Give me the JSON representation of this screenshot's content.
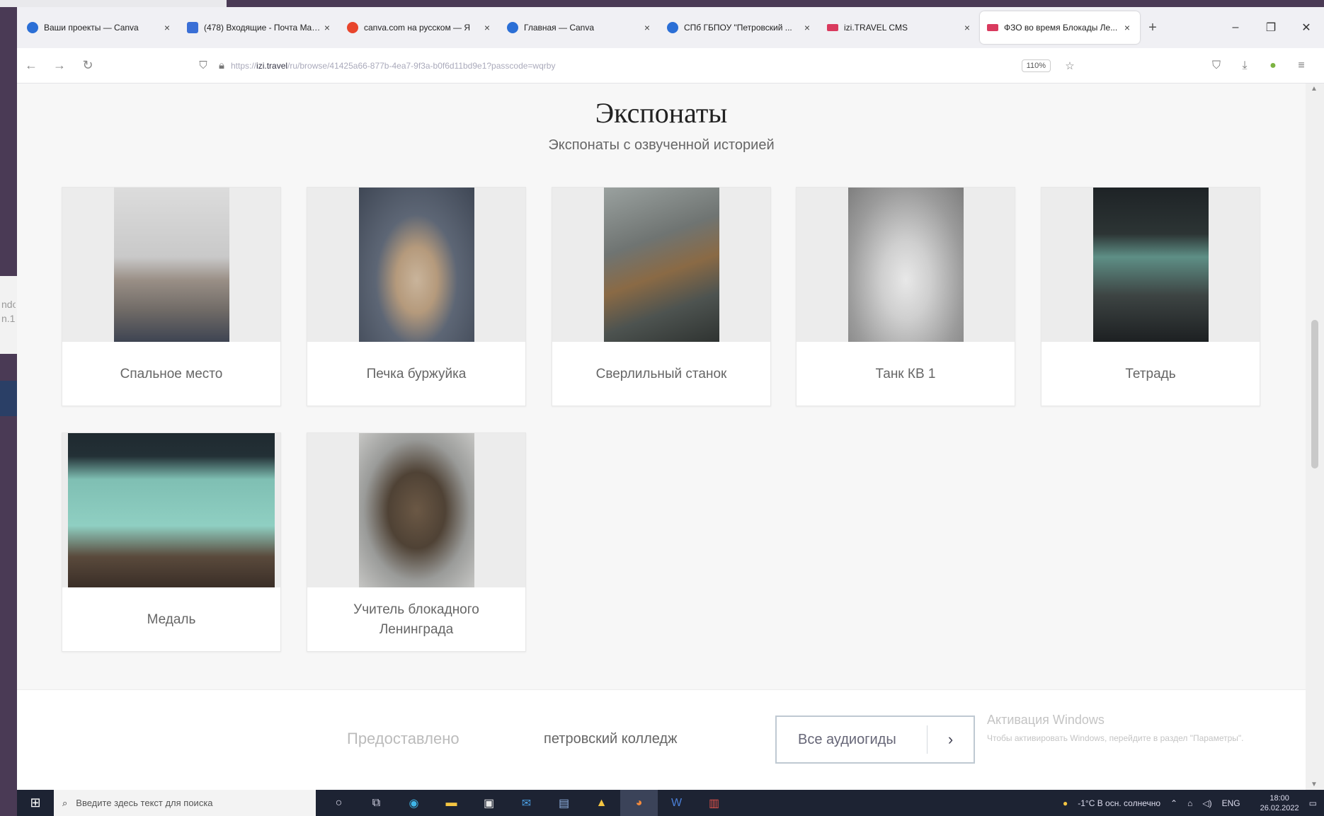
{
  "browser": {
    "tabs": [
      {
        "title": "Ваши проекты — Canva",
        "favicon_color": "#2b6fd6",
        "active": false
      },
      {
        "title": "(478) Входящие - Почта Mail.ru",
        "favicon_color": "#3a6fd6",
        "active": false
      },
      {
        "title": "canva.com на русском — Я",
        "favicon_color": "#e8452c",
        "active": false
      },
      {
        "title": "Главная — Canva",
        "favicon_color": "#2b6fd6",
        "active": false
      },
      {
        "title": "СПб ГБПОУ \"Петровский ...",
        "favicon_color": "#2b6fd6",
        "active": false
      },
      {
        "title": "izi.TRAVEL CMS",
        "favicon_color": "#d93a5e",
        "active": false
      },
      {
        "title": "ФЗО во время Блокады Ле...",
        "favicon_color": "#d93a5e",
        "active": true
      }
    ],
    "new_tab": "+",
    "window_controls": {
      "minimize": "–",
      "restore": "❐",
      "close": "✕"
    },
    "nav": {
      "back": "←",
      "forward": "→",
      "reload": "↻"
    },
    "url_prefix": "https://",
    "url_domain": "izi.travel",
    "url_path": "/ru/browse/41425a66-877b-4ea7-9f3a-b0f6d11bd9e1?passcode=wqrby",
    "zoom": "110%"
  },
  "page": {
    "heading": "Экспонаты",
    "subheading": "Экспонаты с озвученной историей",
    "exhibits": [
      {
        "label": "Спальное место"
      },
      {
        "label": "Печка буржуйка"
      },
      {
        "label": "Сверлильный станок"
      },
      {
        "label": "Танк КВ 1"
      },
      {
        "label": "Тетрадь"
      },
      {
        "label": "Медаль"
      },
      {
        "label": "Учитель блокадного Ленинграда"
      }
    ]
  },
  "footer": {
    "provided_label": "Предоставлено",
    "org_name": "петровский колледж",
    "all_audioguides_label": "Все аудиогиды",
    "arrow": "›"
  },
  "windows_activation": {
    "title": "Активация Windows",
    "text": "Чтобы активировать Windows, перейдите в раздел \"Параметры\"."
  },
  "taskbar": {
    "search_placeholder": "Введите здесь текст для поиска",
    "weather": "-1°C  В осн. солнечно",
    "language": "ENG",
    "time": "18:00",
    "date": "26.02.2022"
  },
  "background_fragments": {
    "side_text": "ndo\nn.1"
  }
}
